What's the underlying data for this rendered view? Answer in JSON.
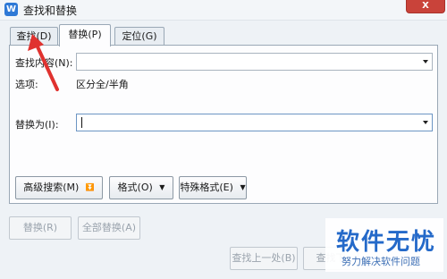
{
  "window": {
    "title": "查找和替换",
    "app_icon_letter": "W",
    "close_label": "X"
  },
  "tabs": [
    {
      "label": "查找(D)",
      "active": false
    },
    {
      "label": "替换(P)",
      "active": true
    },
    {
      "label": "定位(G)",
      "active": false
    }
  ],
  "form": {
    "find_label": "查找内容(N):",
    "find_value": "",
    "options_label": "选项:",
    "options_value": "区分全/半角",
    "replace_label": "替换为(I):",
    "replace_value": ""
  },
  "option_buttons": {
    "advanced_search": "高级搜索(M)",
    "advanced_search_glyph": "⏬",
    "format": "格式(O)",
    "special_format": "特殊格式(E)"
  },
  "action_buttons": {
    "replace": "替换(R)",
    "replace_all": "全部替换(A)",
    "find_previous": "查找上一处(B)",
    "find_next": "查找下"
  },
  "watermark": {
    "title": "软件无忧",
    "subtitle": "努力解决软件问题"
  },
  "colors": {
    "accent": "#2f79d6",
    "close": "#c9433a",
    "annotation_arrow": "#e0322f",
    "watermark": "#2469c9"
  }
}
